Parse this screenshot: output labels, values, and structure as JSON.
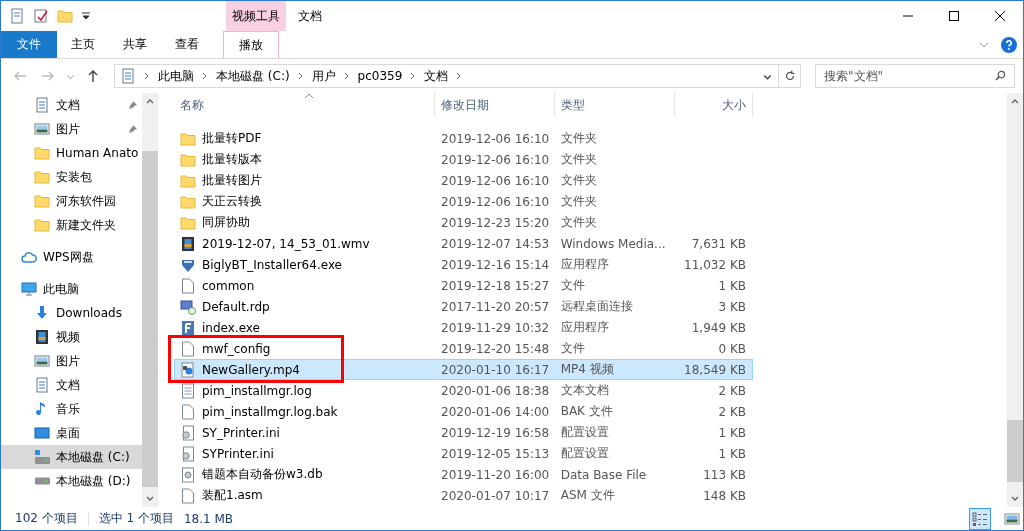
{
  "window": {
    "title": "文档",
    "context_tab_group": "视频工具"
  },
  "ribbon": {
    "tabs": [
      {
        "label": "文件",
        "kind": "file",
        "selected": false
      },
      {
        "label": "主页",
        "kind": "tab",
        "selected": false
      },
      {
        "label": "共享",
        "kind": "tab",
        "selected": false
      },
      {
        "label": "查看",
        "kind": "tab",
        "selected": false
      },
      {
        "label": "播放",
        "kind": "context",
        "selected": true
      }
    ]
  },
  "address": {
    "path": [
      "此电脑",
      "本地磁盘 (C:)",
      "用户",
      "pc0359",
      "文档"
    ]
  },
  "search": {
    "placeholder": "搜索\"文档\""
  },
  "sidebar": {
    "items": [
      {
        "children": [
          {
            "label": "文档",
            "kind": "doc",
            "pinned": true,
            "selected": false
          },
          {
            "label": "图片",
            "kind": "pic",
            "pinned": true,
            "selected": false
          },
          {
            "label": "Human Anato",
            "kind": "folder",
            "pinned": false,
            "selected": false
          },
          {
            "label": "安装包",
            "kind": "folder",
            "pinned": false,
            "selected": false
          },
          {
            "label": "河东软件园",
            "kind": "folder",
            "pinned": false,
            "selected": false
          },
          {
            "label": "新建文件夹",
            "kind": "folder",
            "pinned": false,
            "selected": false
          }
        ]
      },
      {
        "label": "WPS网盘",
        "kind": "cloud",
        "selected": false
      },
      {
        "label": "此电脑",
        "kind": "pc",
        "selected": false,
        "children": [
          {
            "label": "Downloads",
            "kind": "download",
            "selected": false
          },
          {
            "label": "视频",
            "kind": "video",
            "selected": false
          },
          {
            "label": "图片",
            "kind": "pic",
            "selected": false
          },
          {
            "label": "文档",
            "kind": "doc",
            "selected": false
          },
          {
            "label": "音乐",
            "kind": "music",
            "selected": false
          },
          {
            "label": "桌面",
            "kind": "desktop",
            "selected": false
          },
          {
            "label": "本地磁盘 (C:)",
            "kind": "sysdrive",
            "selected": true
          },
          {
            "label": "本地磁盘 (D:)",
            "kind": "drive",
            "selected": false
          }
        ]
      }
    ]
  },
  "table": {
    "columns": [
      {
        "label": "名称",
        "sorted": true
      },
      {
        "label": "修改日期",
        "sorted": false
      },
      {
        "label": "类型",
        "sorted": false
      },
      {
        "label": "大小",
        "sorted": false
      }
    ],
    "rows": [
      {
        "name": "批量转PDF",
        "date": "2019-12-06 16:10",
        "type": "文件夹",
        "size": "",
        "kind": "folder",
        "selected": false,
        "boxed": false
      },
      {
        "name": "批量转版本",
        "date": "2019-12-06 16:10",
        "type": "文件夹",
        "size": "",
        "kind": "folder",
        "selected": false,
        "boxed": false
      },
      {
        "name": "批量转图片",
        "date": "2019-12-06 16:10",
        "type": "文件夹",
        "size": "",
        "kind": "folder",
        "selected": false,
        "boxed": false
      },
      {
        "name": "天正云转换",
        "date": "2019-12-06 16:10",
        "type": "文件夹",
        "size": "",
        "kind": "folder",
        "selected": false,
        "boxed": false
      },
      {
        "name": "同屏协助",
        "date": "2019-12-23 15:20",
        "type": "文件夹",
        "size": "",
        "kind": "folder",
        "selected": false,
        "boxed": false
      },
      {
        "name": "2019-12-07, 14_53_01.wmv",
        "date": "2019-12-07 14:53",
        "type": "Windows Media...",
        "size": "7,631 KB",
        "kind": "video",
        "selected": false,
        "boxed": false
      },
      {
        "name": "BiglyBT_Installer64.exe",
        "date": "2019-12-16 15:14",
        "type": "应用程序",
        "size": "11,032 KB",
        "kind": "installer",
        "selected": false,
        "boxed": false
      },
      {
        "name": "common",
        "date": "2019-12-18 15:27",
        "type": "文件",
        "size": "1 KB",
        "kind": "file",
        "selected": false,
        "boxed": false
      },
      {
        "name": "Default.rdp",
        "date": "2017-11-20 20:57",
        "type": "远程桌面连接",
        "size": "3 KB",
        "kind": "remote",
        "selected": false,
        "boxed": false
      },
      {
        "name": "index.exe",
        "date": "2019-11-29 10:32",
        "type": "应用程序",
        "size": "1,949 KB",
        "kind": "app",
        "selected": false,
        "boxed": false
      },
      {
        "name": "mwf_config",
        "date": "2019-12-20 15:48",
        "type": "文件",
        "size": "0 KB",
        "kind": "file",
        "selected": false,
        "boxed": true
      },
      {
        "name": "NewGallery.mp4",
        "date": "2020-01-10 16:17",
        "type": "MP4 视频",
        "size": "18,549 KB",
        "kind": "media",
        "selected": true,
        "boxed": true
      },
      {
        "name": "pim_installmgr.log",
        "date": "2020-01-06 18:38",
        "type": "文本文档",
        "size": "2 KB",
        "kind": "text",
        "selected": false,
        "boxed": false
      },
      {
        "name": "pim_installmgr.log.bak",
        "date": "2020-01-06 14:00",
        "type": "BAK 文件",
        "size": "2 KB",
        "kind": "file",
        "selected": false,
        "boxed": false
      },
      {
        "name": "SY_Printer.ini",
        "date": "2019-12-19 16:58",
        "type": "配置设置",
        "size": "1 KB",
        "kind": "config",
        "selected": false,
        "boxed": false
      },
      {
        "name": "SYPrinter.ini",
        "date": "2019-12-05 15:13",
        "type": "配置设置",
        "size": "1 KB",
        "kind": "config",
        "selected": false,
        "boxed": false
      },
      {
        "name": "错题本自动备份w3.db",
        "date": "2019-11-20 16:00",
        "type": "Data Base File",
        "size": "113 KB",
        "kind": "database",
        "selected": false,
        "boxed": false
      },
      {
        "name": "装配1.asm",
        "date": "2020-01-07 10:17",
        "type": "ASM 文件",
        "size": "148 KB",
        "kind": "file",
        "selected": false,
        "boxed": false
      }
    ]
  },
  "status_bar": {
    "count": "102 个项目",
    "selection": "选中 1 个项目",
    "size": "18.1 MB"
  },
  "view_buttons": [
    {
      "kind": "details",
      "selected": true
    },
    {
      "kind": "large-icons",
      "selected": false
    }
  ]
}
